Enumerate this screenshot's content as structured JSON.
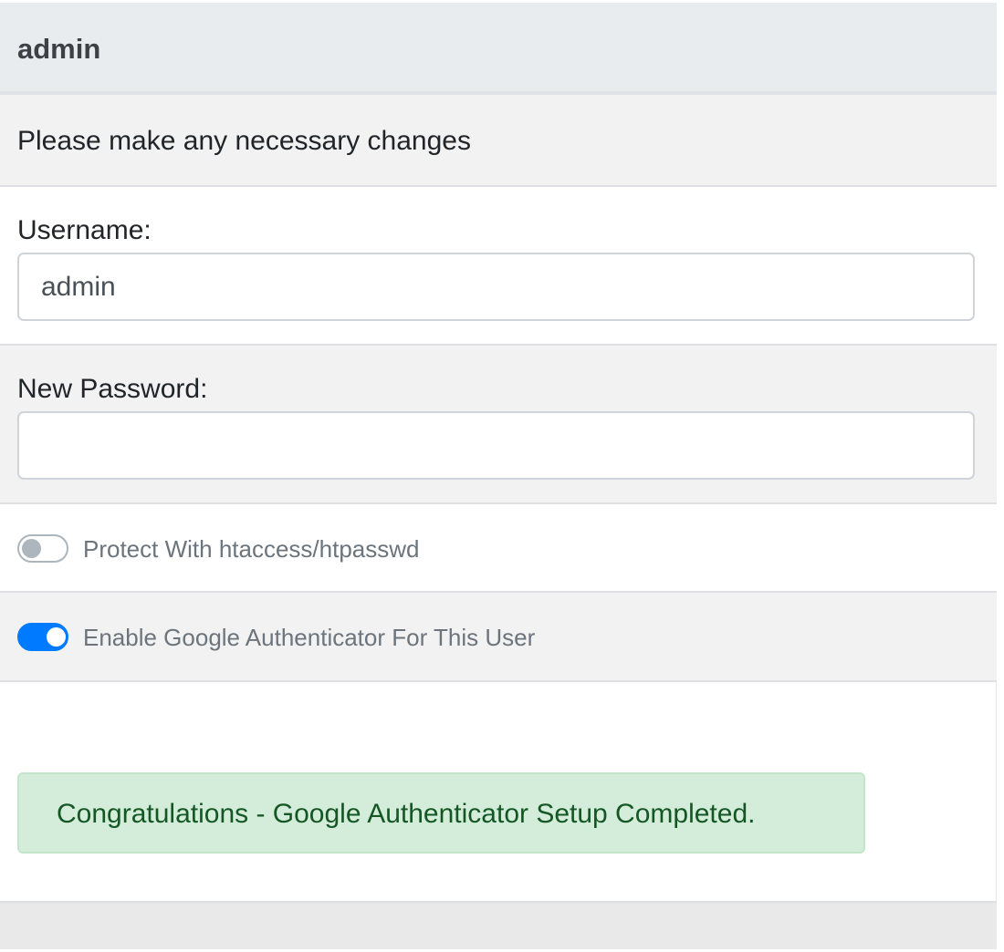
{
  "header": {
    "title": "admin"
  },
  "intro": {
    "text": "Please make any necessary changes"
  },
  "username": {
    "label": "Username:",
    "value": "admin"
  },
  "new_password": {
    "label": "New Password:",
    "value": "",
    "placeholder": ""
  },
  "htaccess_toggle": {
    "label": "Protect With htaccess/htpasswd",
    "checked": false
  },
  "google_auth_toggle": {
    "label": "Enable Google Authenticator For This User",
    "checked": true
  },
  "alert": {
    "message": "Congratulations - Google Authenticator Setup Completed.",
    "type": "success"
  },
  "colors": {
    "accent": "#007bff",
    "success_bg": "#d4edda",
    "success_text": "#155724"
  }
}
